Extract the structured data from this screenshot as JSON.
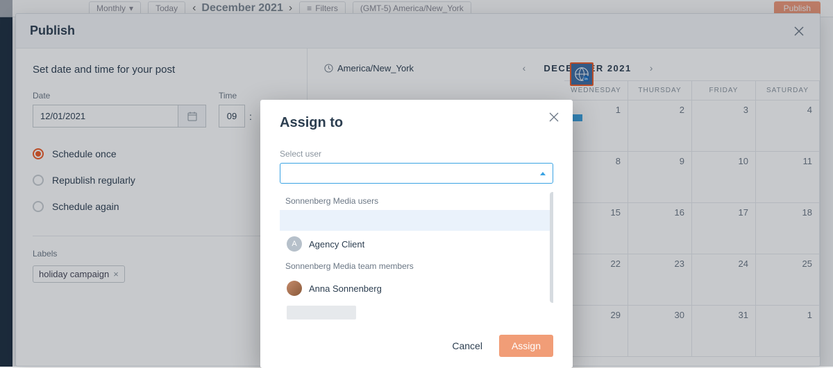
{
  "bg": {
    "view": "Monthly",
    "today": "Today",
    "month": "December 2021",
    "filters": "Filters",
    "tz": "(GMT-5) America/New_York",
    "publish": "Publish"
  },
  "publish": {
    "title": "Publish",
    "subtitle": "Set date and time for your post",
    "date_label": "Date",
    "date_value": "12/01/2021",
    "time_label": "Time",
    "time_hh": "09",
    "schedule_options": [
      "Schedule once",
      "Republish regularly",
      "Schedule again"
    ],
    "selected_option": 0,
    "labels_label": "Labels",
    "chip": "holiday campaign"
  },
  "calendar": {
    "tz": "America/New_York",
    "month": "DECEMBER 2021",
    "days": [
      "WEDNESDAY",
      "THURSDAY",
      "FRIDAY",
      "SATURDAY"
    ],
    "weeks": [
      [
        1,
        2,
        3,
        4
      ],
      [
        8,
        9,
        10,
        11
      ],
      [
        15,
        16,
        17,
        18
      ],
      [
        22,
        23,
        24,
        25
      ],
      [
        29,
        30,
        31,
        1
      ]
    ]
  },
  "assign": {
    "title": "Assign to",
    "select_label": "Select user",
    "group1": "Sonnenberg Media users",
    "user1": "Agency Client",
    "user1_initial": "A",
    "group2": "Sonnenberg Media team members",
    "user2": "Anna Sonnenberg",
    "cancel": "Cancel",
    "assign": "Assign"
  }
}
